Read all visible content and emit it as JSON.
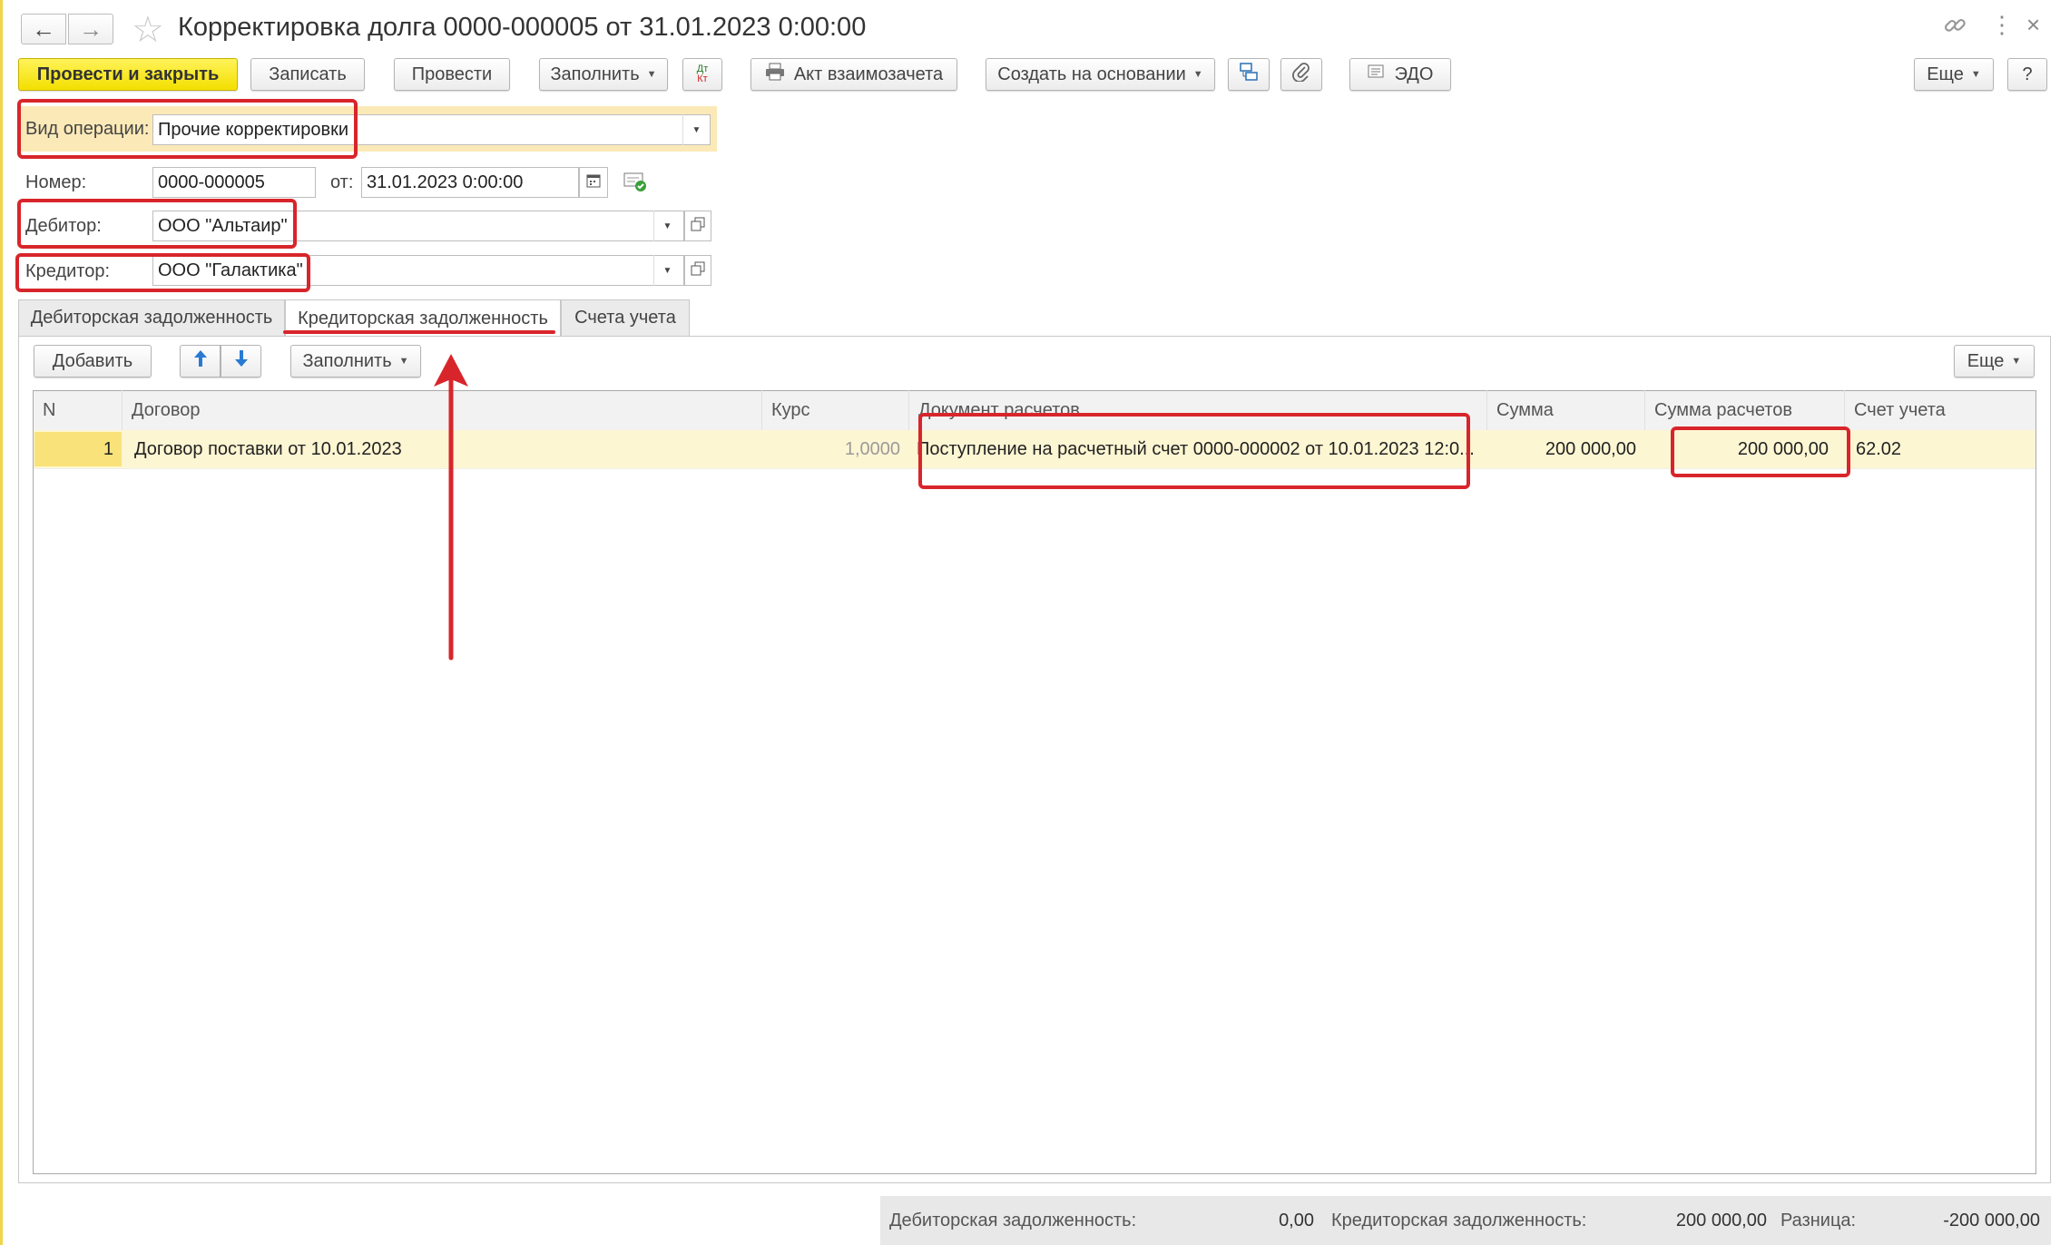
{
  "window": {
    "title": "Корректировка долга 0000-000005 от 31.01.2023 0:00:00"
  },
  "toolbar": {
    "post_close": "Провести и закрыть",
    "save": "Записать",
    "post": "Провести",
    "fill": "Заполнить",
    "dt_kt": "Дт Кт",
    "act": "Акт взаимозачета",
    "create_based": "Создать на основании",
    "edo": "ЭДО",
    "more": "Еще",
    "help": "?"
  },
  "form": {
    "operation_label": "Вид операции:",
    "operation_value": "Прочие корректировки",
    "number_label": "Номер:",
    "number_value": "0000-000005",
    "date_label": "от:",
    "date_value": "31.01.2023  0:00:00",
    "debtor_label": "Дебитор:",
    "debtor_value": "ООО \"Альтаир\"",
    "creditor_label": "Кредитор:",
    "creditor_value": "ООО \"Галактика\""
  },
  "tabs": [
    {
      "label": "Дебиторская задолженность"
    },
    {
      "label": "Кредиторская задолженность"
    },
    {
      "label": "Счета учета"
    }
  ],
  "table_toolbar": {
    "add": "Добавить",
    "fill": "Заполнить",
    "more": "Еще"
  },
  "table": {
    "headers": [
      "N",
      "Договор",
      "Курс",
      "Документ расчетов",
      "Сумма",
      "Сумма расчетов",
      "Счет учета"
    ],
    "rows": [
      {
        "n": "1",
        "contract": "Договор поставки от 10.01.2023",
        "rate": "1,0000",
        "document": "Поступление на расчетный счет 0000-000002 от 10.01.2023 12:0...",
        "sum": "200 000,00",
        "settlement_sum": "200 000,00",
        "account": "62.02"
      }
    ]
  },
  "footer": {
    "receivable_label": "Дебиторская задолженность:",
    "receivable_value": "0,00",
    "payable_label": "Кредиторская задолженность:",
    "payable_value": "200 000,00",
    "difference_label": "Разница:",
    "difference_value": "-200 000,00"
  },
  "colors": {
    "accent_yellow": "#f7e600",
    "highlight_red": "#d8252b",
    "row_highlight": "#fdf6d3",
    "operation_bg": "#fbe9b7"
  }
}
